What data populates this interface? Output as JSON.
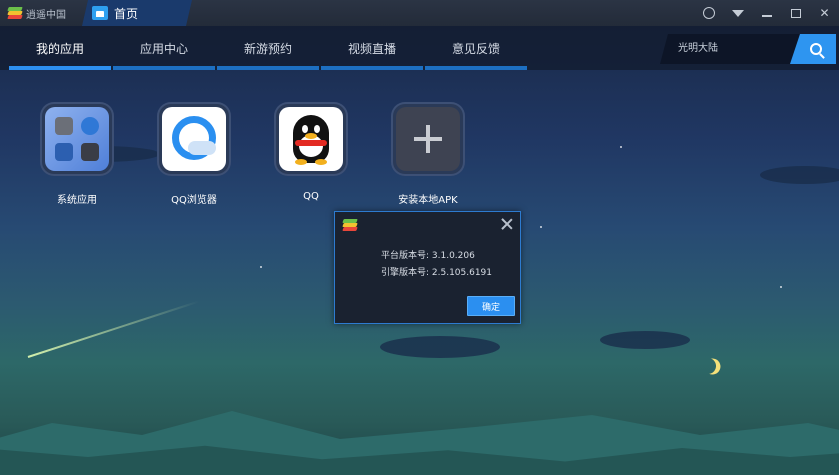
{
  "titlebar": {
    "brand_label": "逍遥中国",
    "home_tab_label": "首页"
  },
  "nav": {
    "tabs": [
      {
        "label": "我的应用",
        "active": true
      },
      {
        "label": "应用中心",
        "active": false
      },
      {
        "label": "新游预约",
        "active": false
      },
      {
        "label": "视频直播",
        "active": false
      },
      {
        "label": "意见反馈",
        "active": false
      }
    ],
    "search_value": "光明大陆"
  },
  "apps": [
    {
      "label": "系统应用",
      "icon": "system-apps-icon"
    },
    {
      "label": "QQ浏览器",
      "icon": "qq-browser-icon"
    },
    {
      "label": "QQ",
      "icon": "qq-penguin-icon"
    },
    {
      "label": "安装本地APK",
      "icon": "plus-icon"
    }
  ],
  "dialog": {
    "platform_version": "平台版本号: 3.1.0.206",
    "engine_version": "引擎版本号: 2.5.105.6191",
    "ok_label": "确定"
  },
  "colors": {
    "accent": "#2e95f0",
    "logo_green": "#6cc04a",
    "logo_yellow": "#f2c230",
    "logo_red": "#e8473a"
  }
}
